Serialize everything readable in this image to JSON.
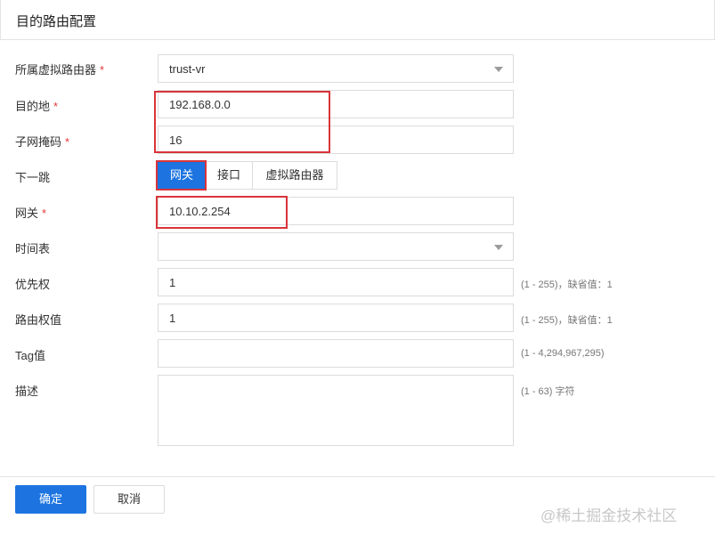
{
  "header": {
    "title": "目的路由配置"
  },
  "form": {
    "vrouter": {
      "label": "所属虚拟路由器",
      "required": "*",
      "value": "trust-vr"
    },
    "destination": {
      "label": "目的地",
      "required": "*",
      "value": "192.168.0.0"
    },
    "subnet_mask": {
      "label": "子网掩码",
      "required": "*",
      "value": "16"
    },
    "next_hop": {
      "label": "下一跳",
      "options": [
        "网关",
        "接口",
        "虚拟路由器"
      ],
      "selected": "网关"
    },
    "gateway": {
      "label": "网关",
      "required": "*",
      "value": "10.10.2.254"
    },
    "schedule": {
      "label": "时间表",
      "value": ""
    },
    "priority": {
      "label": "优先权",
      "value": "1",
      "hint": "(1 - 255)，缺省值：1"
    },
    "route_weight": {
      "label": "路由权值",
      "value": "1",
      "hint": "(1 - 255)，缺省值：1"
    },
    "tag": {
      "label": "Tag值",
      "value": "",
      "hint": "(1 - 4,294,967,295)"
    },
    "description": {
      "label": "描述",
      "value": "",
      "hint": "(1 - 63) 字符"
    }
  },
  "footer": {
    "confirm_label": "确定",
    "cancel_label": "取消"
  },
  "watermark": "@稀土掘金技术社区",
  "colors": {
    "primary": "#1d74e0",
    "highlight": "#d9343a",
    "required": "#e4393c"
  }
}
